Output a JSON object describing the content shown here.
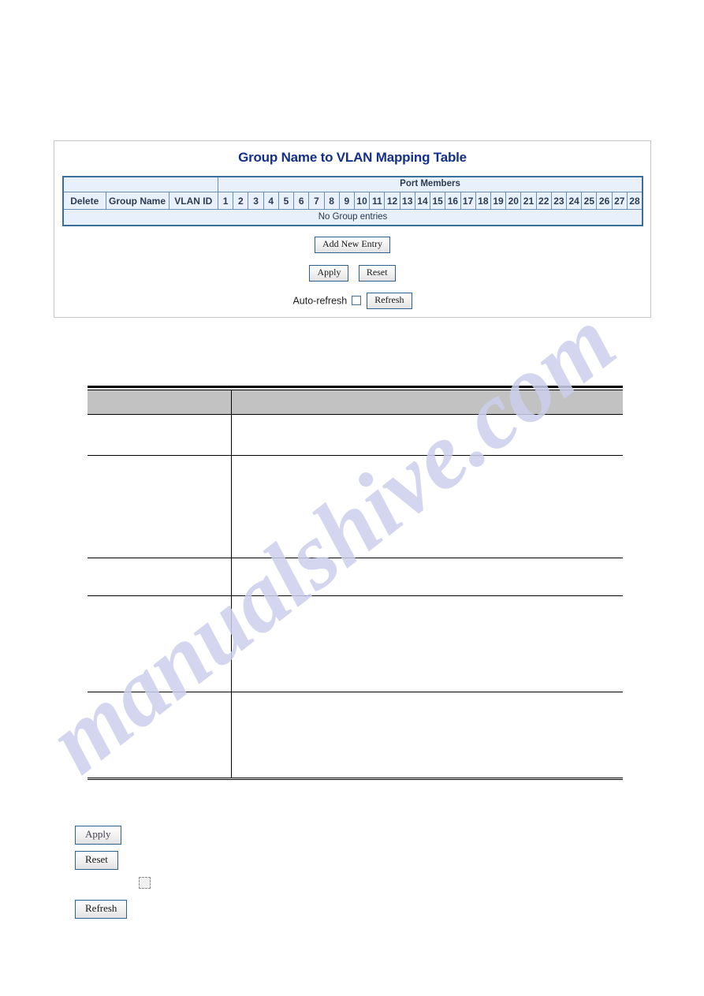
{
  "page": {
    "watermark_text": "manualshive.com"
  },
  "ui_panel": {
    "title": "Group Name to VLAN Mapping Table",
    "table": {
      "port_members_header": "Port Members",
      "columns": [
        "Delete",
        "Group Name",
        "VLAN ID"
      ],
      "ports": [
        "1",
        "2",
        "3",
        "4",
        "5",
        "6",
        "7",
        "8",
        "9",
        "10",
        "11",
        "12",
        "13",
        "14",
        "15",
        "16",
        "17",
        "18",
        "19",
        "20",
        "21",
        "22",
        "23",
        "24",
        "25",
        "26",
        "27",
        "28"
      ],
      "empty_message": "No Group entries"
    },
    "buttons": {
      "add_new_entry": "Add New Entry",
      "apply": "Apply",
      "reset": "Reset",
      "refresh": "Refresh"
    },
    "auto_refresh": {
      "label": "Auto-refresh",
      "checked": false
    }
  },
  "description_table": {
    "headers": [
      "",
      ""
    ],
    "rows": [
      [
        "",
        ""
      ],
      [
        "",
        ""
      ],
      [
        "",
        ""
      ],
      [
        "",
        ""
      ],
      [
        "",
        ""
      ]
    ]
  },
  "legend": {
    "apply_label": "Apply",
    "reset_label": "Reset",
    "refresh_label": "Refresh",
    "checkbox_label": ""
  },
  "colors": {
    "title_blue": "#13308e",
    "table_border_blue": "#3a6f9a",
    "table_fill_blue": "#e8f0fb",
    "desc_header_gray": "#c2c2c2",
    "watermark_lavender": "#cdd0ee"
  }
}
